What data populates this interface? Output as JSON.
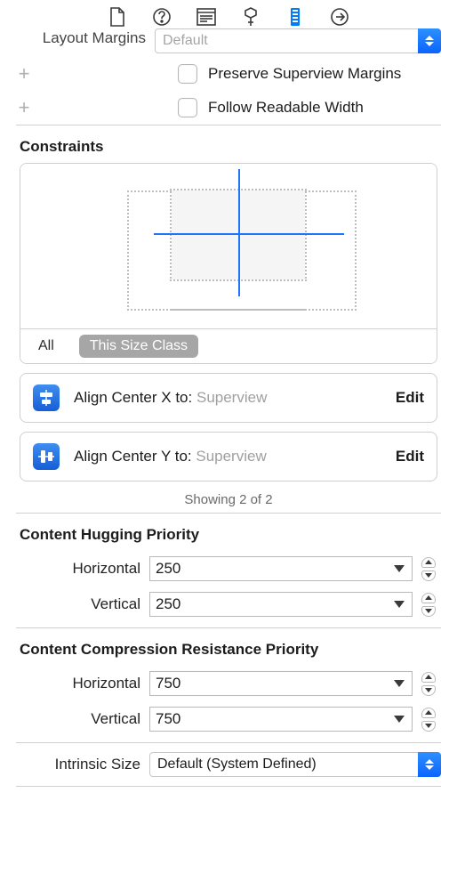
{
  "toolbar_icons": [
    "document-icon",
    "help-icon",
    "identity-icon",
    "attributes-icon",
    "size-icon",
    "go-icon"
  ],
  "layoutMargins": {
    "label": "Layout Margins",
    "value": "Default",
    "preserve": "Preserve Superview Margins",
    "follow": "Follow Readable Width"
  },
  "constraints": {
    "title": "Constraints",
    "tabs": {
      "all": "All",
      "thisSize": "This Size Class"
    },
    "items": [
      {
        "label": "Align Center X to:",
        "target": "Superview",
        "edit": "Edit",
        "axis": "x"
      },
      {
        "label": "Align Center Y to:",
        "target": "Superview",
        "edit": "Edit",
        "axis": "y"
      }
    ],
    "caption": "Showing 2 of 2"
  },
  "hugging": {
    "title": "Content Hugging Priority",
    "horizontal_label": "Horizontal",
    "horizontal": "250",
    "vertical_label": "Vertical",
    "vertical": "250"
  },
  "compression": {
    "title": "Content Compression Resistance Priority",
    "horizontal_label": "Horizontal",
    "horizontal": "750",
    "vertical_label": "Vertical",
    "vertical": "750"
  },
  "intrinsic": {
    "label": "Intrinsic Size",
    "value": "Default (System Defined)"
  }
}
